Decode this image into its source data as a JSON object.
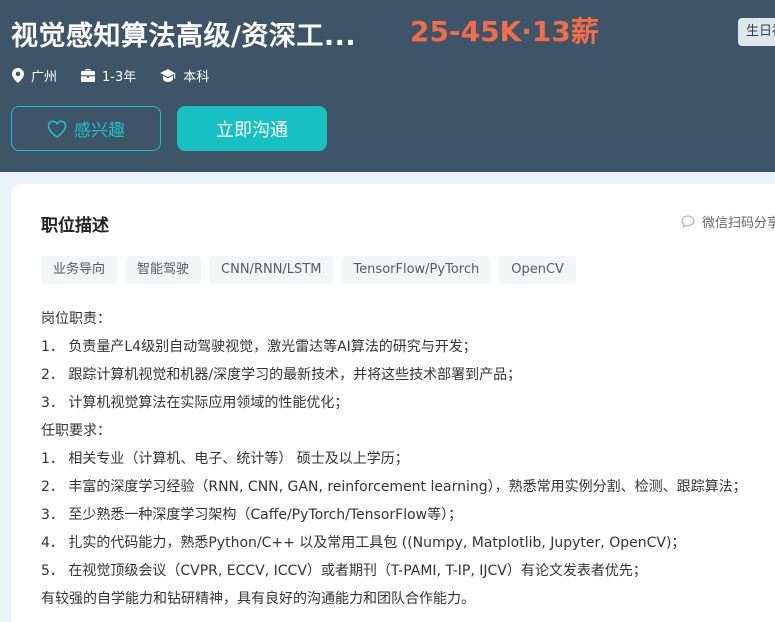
{
  "header": {
    "title": "视觉感知算法高级/资深工...",
    "salary": "25-45K·13薪",
    "badge": "生日福",
    "location": "广州",
    "experience": "1-3年",
    "education": "本科",
    "interest_button": "感兴趣",
    "chat_button": "立即沟通"
  },
  "card": {
    "section_title": "职位描述",
    "share_label": "微信扫码分享",
    "tags": [
      "业务导向",
      "智能驾驶",
      "CNN/RNN/LSTM",
      "TensorFlow/PyTorch",
      "OpenCV"
    ],
    "description": [
      "岗位职责：",
      "1． 负责量产L4级别自动驾驶视觉，激光雷达等AI算法的研究与开发；",
      "2． 跟踪计算机视觉和机器/深度学习的最新技术，并将这些技术部署到产品；",
      "3． 计算机视觉算法在实际应用领域的性能优化；",
      "任职要求：",
      "1． 相关专业（计算机、电子、统计等） 硕士及以上学历；",
      "2． 丰富的深度学习经验（RNN, CNN, GAN, reinforcement learning），熟悉常用实例分割、检测、跟踪算法；",
      "3． 至少熟悉一种深度学习架构（Caffe/PyTorch/TensorFlow等）；",
      "4． 扎实的代码能力，熟悉Python/C++ 以及常用工具包 ((Numpy, Matplotlib, Jupyter, OpenCV)；",
      "5． 在视觉顶级会议（CVPR, ECCV, ICCV）或者期刊（T-PAMI, T-IP, IJCV）有论文发表者优先；",
      "有较强的自学能力和钻研精神，具有良好的沟通能力和团队合作能力。"
    ]
  },
  "colors": {
    "header_bg": "#3e5569",
    "salary": "#f26d49",
    "accent": "#16c0c3",
    "page_bg": "#eaf4f6"
  },
  "icons": [
    "location-icon",
    "briefcase-icon",
    "graduation-cap-icon",
    "heart-icon",
    "chat-bubble-icon"
  ]
}
